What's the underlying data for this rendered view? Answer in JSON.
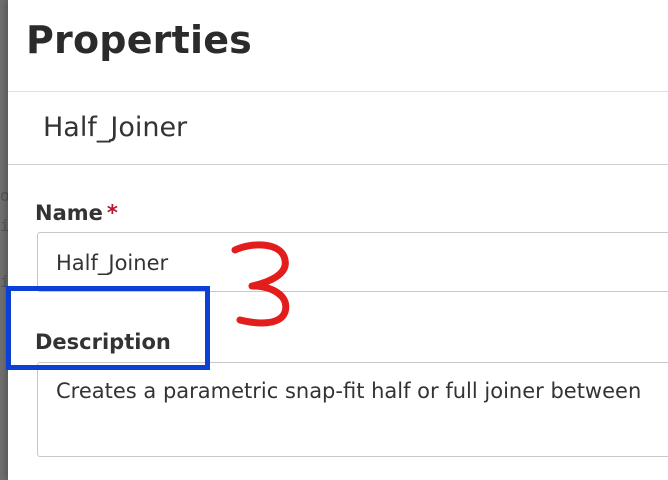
{
  "panel": {
    "title": "Properties",
    "feature_name": "Half_Joiner"
  },
  "fields": {
    "name": {
      "label": "Name",
      "required_marker": "*",
      "value": "Half_Joiner"
    },
    "description": {
      "label": "Description",
      "value": "Creates a parametric snap-fit half or full joiner between"
    }
  },
  "annotations": {
    "step_number": "3",
    "number_color": "#e31c1c",
    "highlight_color": "#0b3fd6"
  },
  "background_editor": {
    "fragments": [
      "o",
      "i",
      "i"
    ]
  }
}
